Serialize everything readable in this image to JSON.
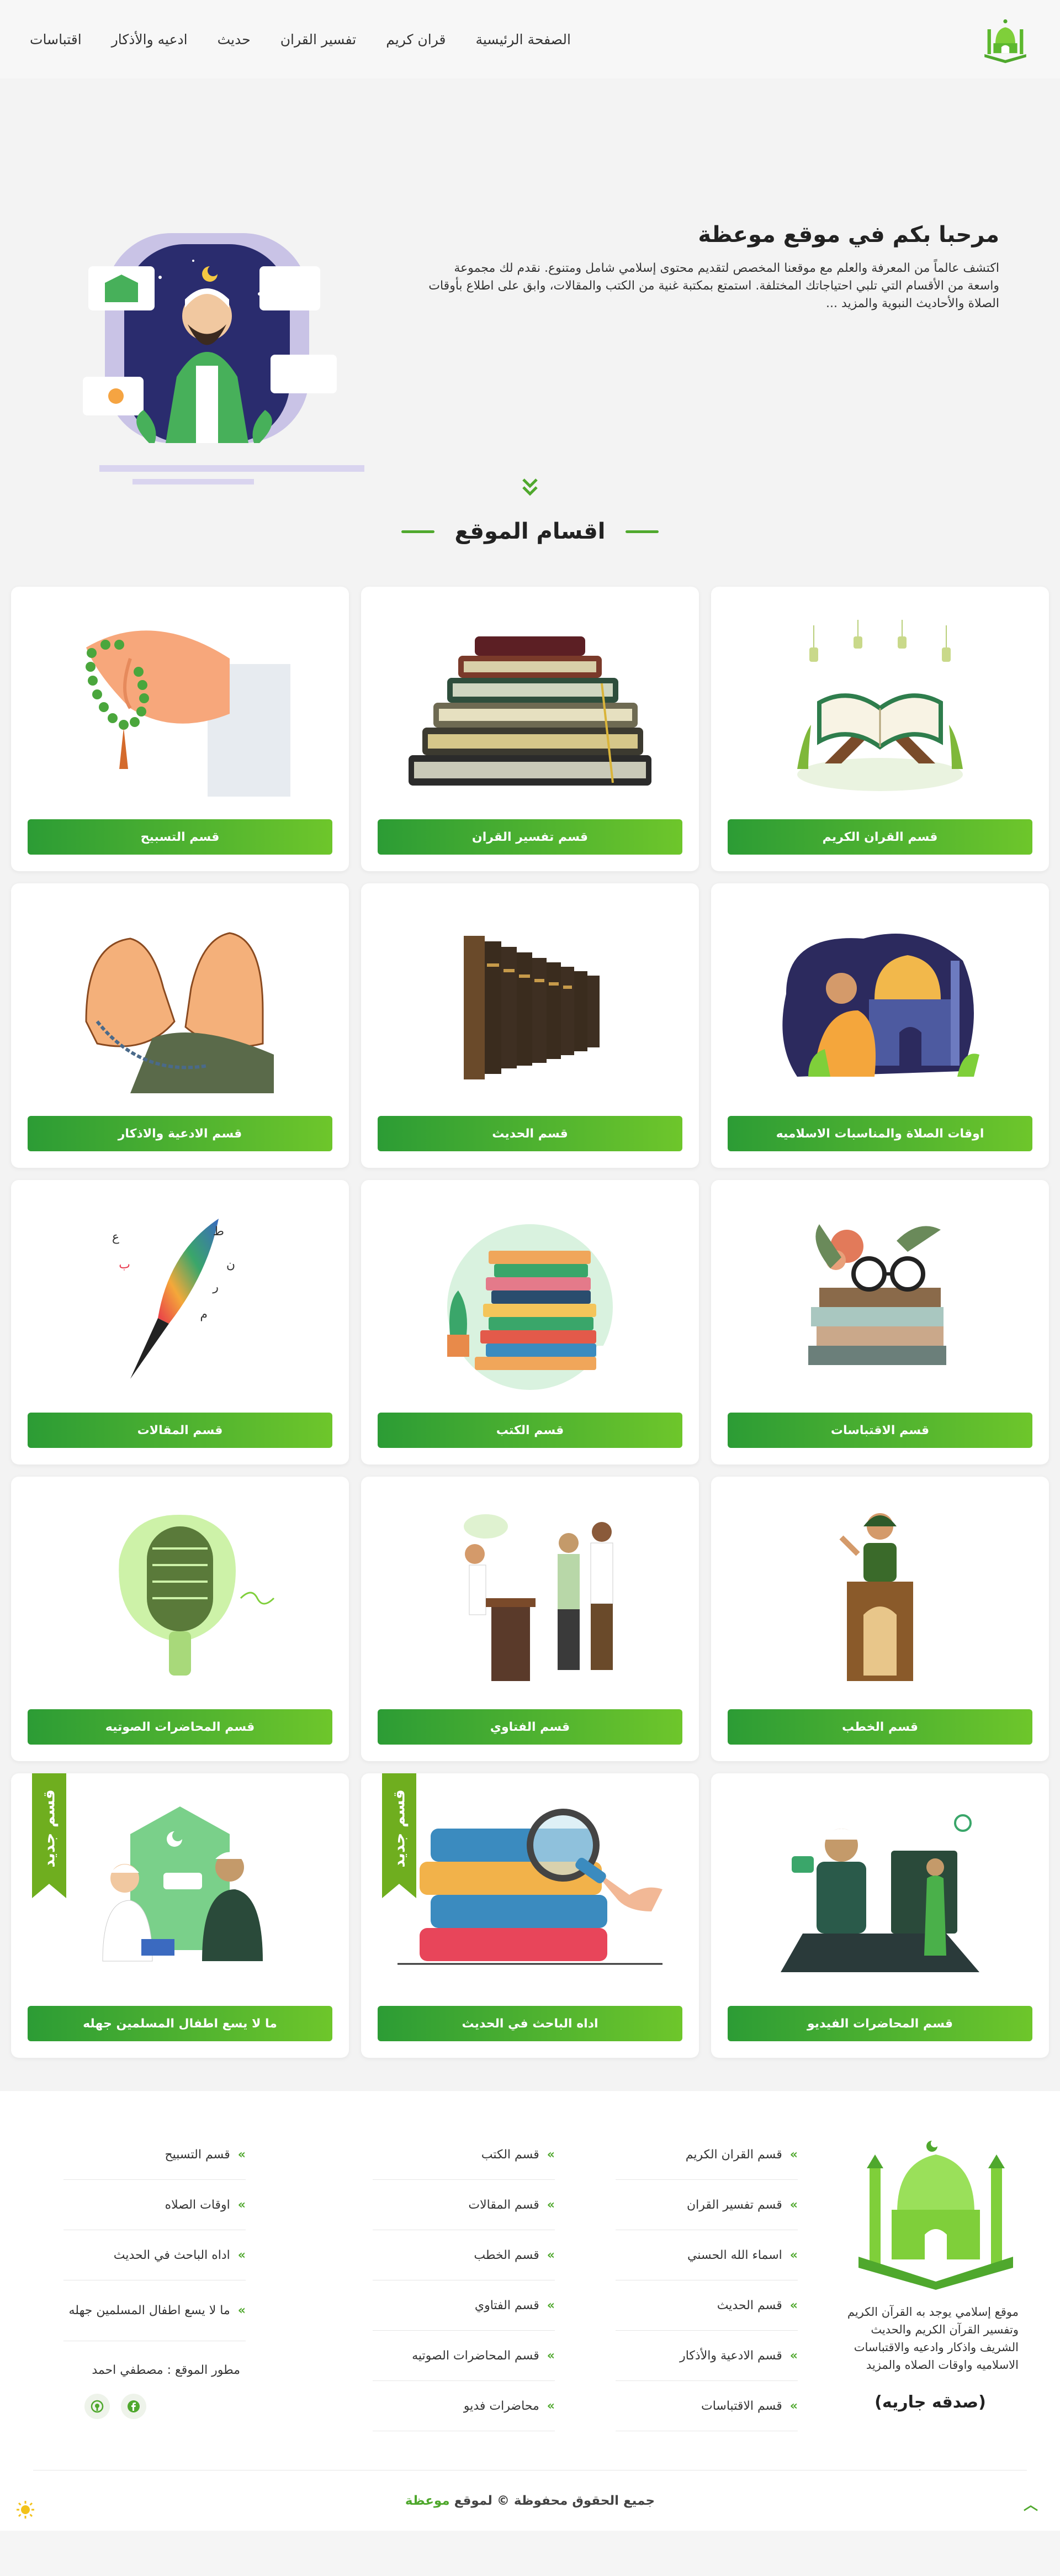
{
  "nav": {
    "items": [
      "الصفحة الرئيسية",
      "قران كريم",
      "تفسير القران",
      "حديث",
      "ادعيه والأذكار",
      "اقتباسات"
    ]
  },
  "hero": {
    "title": "مرحبا بكم في موقع موعظة",
    "description": "اكتشف عالماً من المعرفة والعلم مع موقعنا المخصص لتقديم محتوى إسلامي شامل ومتنوع. نقدم لك مجموعة واسعة من الأقسام التي تلبي احتياجاتك المختلفة. استمتع بمكتبة غنية من الكتب والمقالات، وابق على اطلاع بأوقات الصلاة والأحاديث النبوية والمزيد ..."
  },
  "sections": {
    "title": "اقسام الموقع",
    "new_badge": "قسم جديد",
    "cards": [
      {
        "label": "قسم القران الكريم",
        "art": "quran-stand",
        "new": false
      },
      {
        "label": "قسم تفسير القران",
        "art": "book-stack",
        "new": false
      },
      {
        "label": "قسم التسبيح",
        "art": "prayer-beads",
        "new": false
      },
      {
        "label": "اوقات الصلاة والمناسبات الاسلاميه",
        "art": "mosque-man",
        "new": false
      },
      {
        "label": "قسم الحديث",
        "art": "hadith-books",
        "new": false
      },
      {
        "label": "قسم الادعية والاذكار",
        "art": "praying-hands",
        "new": false
      },
      {
        "label": "قسم الاقتباسات",
        "art": "books-glasses",
        "new": false
      },
      {
        "label": "قسم الكتب",
        "art": "colorful-books",
        "new": false
      },
      {
        "label": "قسم المقالات",
        "art": "pen-letters",
        "new": false
      },
      {
        "label": "قسم الخطب",
        "art": "pulpit",
        "new": false
      },
      {
        "label": "قسم الفتاوي",
        "art": "fatwa-people",
        "new": false
      },
      {
        "label": "قسم المحاضرات الصوتيه",
        "art": "microphone",
        "new": false
      },
      {
        "label": "قسم المحاضرات الفيديو",
        "art": "video-laptop",
        "new": false
      },
      {
        "label": "اداه الباحث في الحديث",
        "art": "magnifier-books",
        "new": true
      },
      {
        "label": "ما لا يسع اطفال المسلمين جهله",
        "art": "kids-learning",
        "new": true
      }
    ]
  },
  "footer": {
    "about": "موقع إسلامي يوجد به القرآن الكريم وتفسير القرآن الكريم والحديث الشريف واذكار وادعيه والاقتباسات الاسلاميه واوقات الصلاه والمزيد",
    "sadaqa": "(صدقه جاريه)",
    "col1": [
      "قسم القران الكريم",
      "قسم تفسير القران",
      "اسماء الله الحسني",
      "قسم الحديث",
      "قسم الادعية والأذكار",
      "قسم الاقتباسات"
    ],
    "col2": [
      "قسم الكتب",
      "قسم المقالات",
      "قسم الخطب",
      "قسم الفتاوي",
      "قسم المحاضرات الصوتيه",
      "محاضرات فديو"
    ],
    "col3": [
      "قسم التسبيح",
      "اوقات الصلاه",
      "اداه الباحث في الحديث",
      "ما لا يسع اطفال المسلمين جهله"
    ],
    "developer": "مطور الموقع : مصطفي احمد",
    "copyright_text": "جميع الحقوق محفوظة © لموقع",
    "copyright_brand": "موعظة"
  },
  "colors": {
    "accent": "#4fa82d",
    "button_start": "#2c9c35",
    "button_end": "#6ec62b",
    "ribbon": "#6fae1f"
  }
}
